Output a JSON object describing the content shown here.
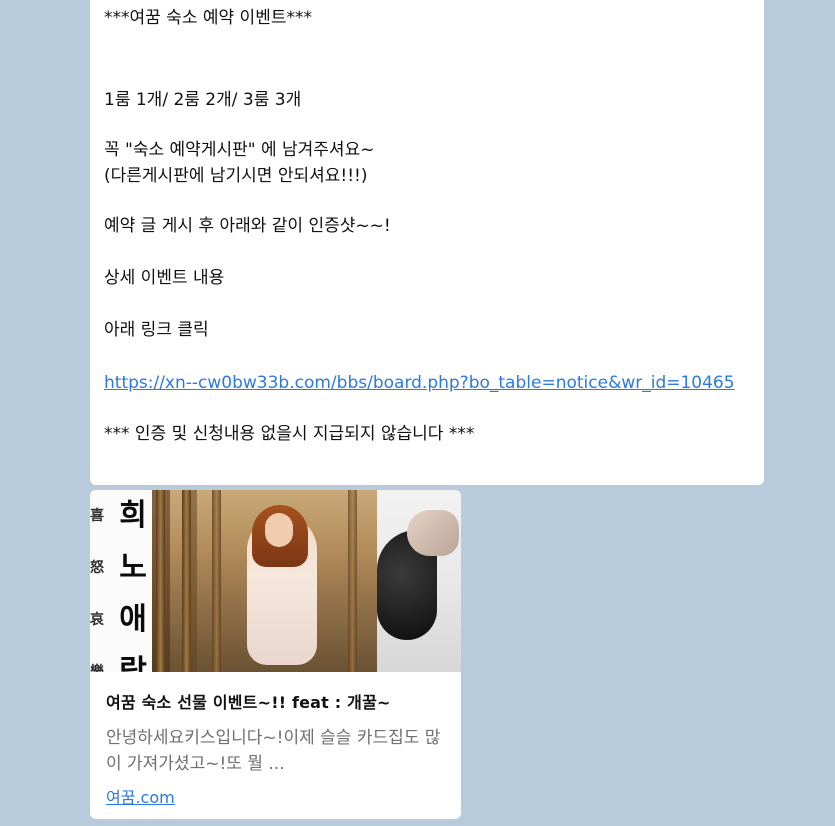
{
  "message": {
    "lines": [
      "***여꿈 숙소 예약 이벤트***",
      "1룸 1개/ 2룸 2개/ 3룸 3개",
      "꼭  \"숙소 예약게시판\" 에 남겨주셔요~",
      "(다른게시판에 남기시면 안되셔요!!!)",
      "예약 글 게시 후 아래와 같이 인증샷~~!",
      "상세 이벤트 내용",
      "아래 링크 클릭",
      "*** 인증 및 신청내용 없을시 지급되지 않습니다 ***"
    ],
    "link_url": "https://xn--cw0bw33b.com/bbs/board.php?bo_table=notice&wr_id=10465"
  },
  "preview": {
    "calligraphy_main": "희노애락",
    "calligraphy_side": "喜怒哀樂",
    "title": "여꿈 숙소 선물 이벤트~!! feat : 개꿀~",
    "description": "안녕하세요키스입니다~!이제 슬슬 카드집도 많이 가져가셨고~!또 뭘 ...",
    "site": "여꿈.com"
  },
  "colors": {
    "background": "#b7cbdc",
    "bubble": "#ffffff",
    "link": "#2a7ae2",
    "muted_text": "#707070"
  }
}
